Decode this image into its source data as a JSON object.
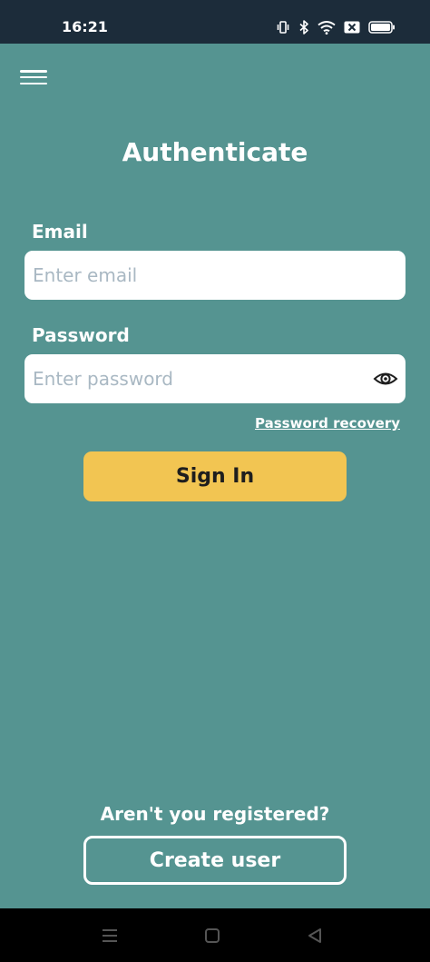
{
  "status_bar": {
    "time": "16:21",
    "icons": [
      "vibrate-icon",
      "bluetooth-icon",
      "wifi-icon",
      "sim-off-icon",
      "battery-icon"
    ]
  },
  "header": {
    "menu_icon": "hamburger-menu-icon",
    "title": "Authenticate"
  },
  "form": {
    "email_label": "Email",
    "email_placeholder": "Enter email",
    "email_value": "",
    "password_label": "Password",
    "password_placeholder": "Enter password",
    "password_value": "",
    "password_toggle_icon": "eye-icon",
    "recovery_link": "Password recovery",
    "signin_label": "Sign In"
  },
  "footer": {
    "register_prompt": "Aren't you registered?",
    "create_user_label": "Create user"
  },
  "nav_bar": {
    "icons": [
      "recents-icon",
      "home-icon",
      "back-icon"
    ]
  },
  "colors": {
    "background": "#559491",
    "status_bar": "#1c2c3a",
    "primary_button": "#f2c552",
    "input_background": "#ffffff",
    "placeholder": "#a9b8c3"
  }
}
